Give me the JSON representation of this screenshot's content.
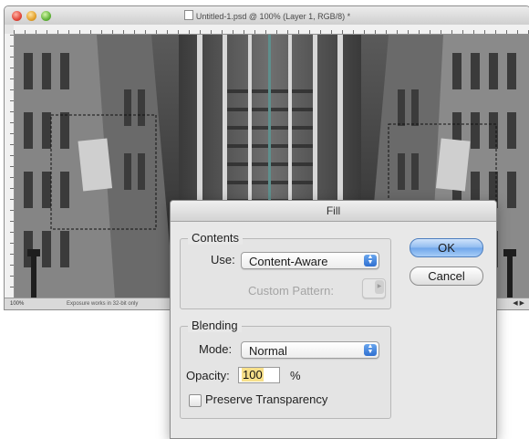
{
  "document_window": {
    "title": "Untitled-1.psd @ 100% (Layer 1, RGB/8) *",
    "status_zoom": "100%",
    "status_info": "Exposure works in 32-bit only",
    "status_arrows": "◀ ▶"
  },
  "fill_dialog": {
    "title": "Fill",
    "contents": {
      "legend": "Contents",
      "use_label": "Use:",
      "use_value": "Content-Aware",
      "custom_pattern_label": "Custom Pattern:"
    },
    "blending": {
      "legend": "Blending",
      "mode_label": "Mode:",
      "mode_value": "Normal",
      "opacity_label": "Opacity:",
      "opacity_value": "100",
      "opacity_unit": "%",
      "preserve_transparency_label": "Preserve Transparency",
      "preserve_transparency_checked": false
    },
    "ok_label": "OK",
    "cancel_label": "Cancel"
  },
  "icons": [
    "psd-file-icon",
    "popup-stepper-icon",
    "checkbox-icon"
  ],
  "colors": {
    "ok_button": "#6ea5ea",
    "opacity_selection": "#f7e08a",
    "dialog_background": "#e8e8e8"
  }
}
